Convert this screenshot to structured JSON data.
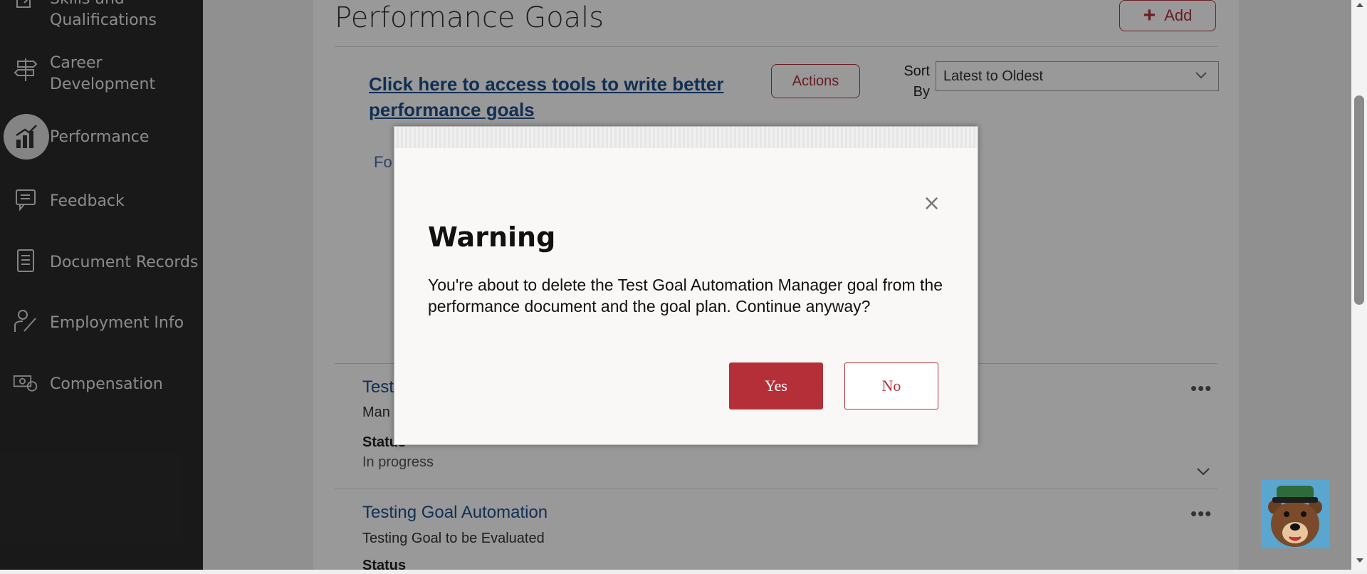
{
  "sidebar": {
    "items": [
      {
        "label": "Skills and Qualifications",
        "icon": "pencil-check-icon"
      },
      {
        "label": "Career Development",
        "icon": "signpost-icon"
      },
      {
        "label": "Performance",
        "icon": "bar-chart-icon",
        "active": true
      },
      {
        "label": "Feedback",
        "icon": "feedback-icon"
      },
      {
        "label": "Document Records",
        "icon": "document-icon"
      },
      {
        "label": "Employment Info",
        "icon": "person-edit-icon"
      },
      {
        "label": "Compensation",
        "icon": "money-icon"
      }
    ]
  },
  "main": {
    "title": "Performance Goals",
    "add_label": "Add",
    "tools_link": "Click here to access tools to write better performance goals",
    "actions_label": "Actions",
    "sort_label": "Sort By",
    "sort_value": "Latest to Oldest",
    "filter_text": "Fo",
    "goals": [
      {
        "title": "Test",
        "desc": "Man",
        "status_label": "Status",
        "status_value": "In progress"
      },
      {
        "title": "Testing Goal Automation",
        "desc": "Testing Goal to be Evaluated",
        "status_label": "Status"
      }
    ]
  },
  "dialog": {
    "title": "Warning",
    "message": "You're about to delete the Test Goal Automation Manager goal from the performance document and the goal plan. Continue anyway?",
    "close": "×",
    "yes_label": "Yes",
    "no_label": "No"
  },
  "colors": {
    "accent": "#b52f39",
    "link": "#1f4f8a",
    "sidebar_bg": "#2b2b2b"
  }
}
